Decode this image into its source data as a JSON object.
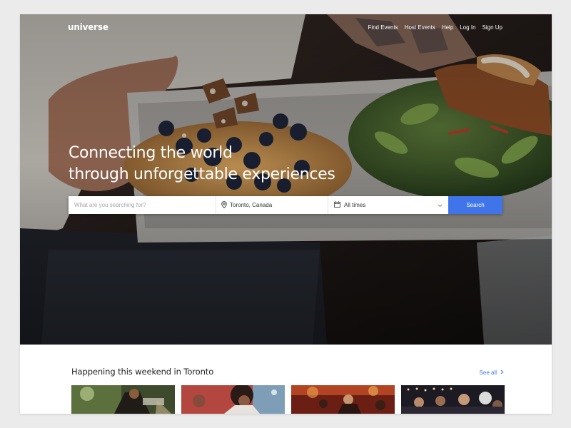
{
  "brand": {
    "logo_text": "universe"
  },
  "nav": {
    "links": [
      {
        "label": "Find Events"
      },
      {
        "label": "Host Events"
      },
      {
        "label": "Help"
      },
      {
        "label": "Log In"
      },
      {
        "label": "Sign Up"
      }
    ]
  },
  "hero": {
    "headline_line1": "Connecting the world",
    "headline_line2": "through unforgettable experiences",
    "photo_icon": "food-tray-photo"
  },
  "search": {
    "query_placeholder": "What are you searching for?",
    "query_value": "",
    "location_value": "Toronto, Canada",
    "location_icon": "location-pin-icon",
    "date_value": "All times",
    "date_icon": "calendar-icon",
    "button_label": "Search"
  },
  "weekend": {
    "title": "Happening this weekend in Toronto",
    "see_all_label": "See all",
    "cards": [
      {
        "thumb": "event-photo-dj"
      },
      {
        "thumb": "event-photo-party"
      },
      {
        "thumb": "event-photo-stage"
      },
      {
        "thumb": "event-photo-crowd"
      }
    ]
  },
  "colors": {
    "accent": "#3f75e8",
    "page_background": "#ebebeb",
    "text_dark": "#222222"
  }
}
